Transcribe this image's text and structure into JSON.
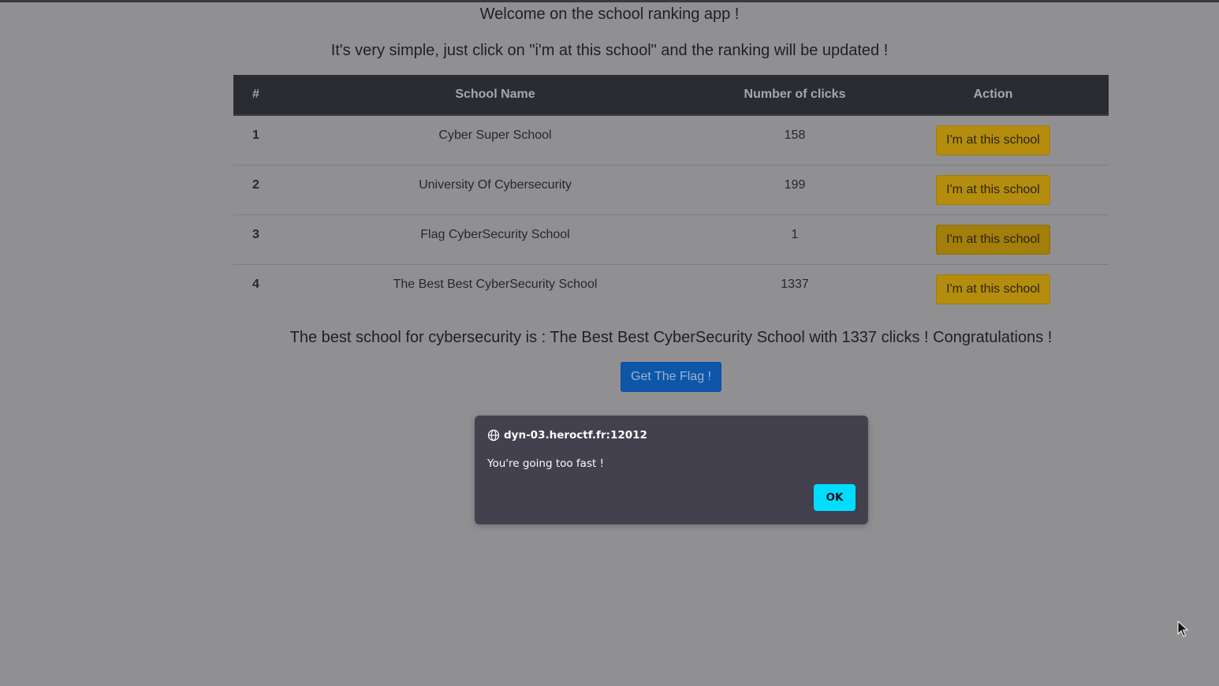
{
  "header": {
    "welcome": "Welcome on the school ranking app !",
    "intro": "It's very simple, just click on \"i'm at this school\" and the ranking will be updated !"
  },
  "table": {
    "columns": [
      "#",
      "School Name",
      "Number of clicks",
      "Action"
    ],
    "rows": [
      {
        "rank": "1",
        "name": "Cyber Super School",
        "clicks": "158",
        "action": "I'm at this school"
      },
      {
        "rank": "2",
        "name": "University Of Cybersecurity",
        "clicks": "199",
        "action": "I'm at this school"
      },
      {
        "rank": "3",
        "name": "Flag CyberSecurity School",
        "clicks": "1",
        "action": "I'm at this school"
      },
      {
        "rank": "4",
        "name": "The Best Best CyberSecurity School",
        "clicks": "1337",
        "action": "I'm at this school"
      }
    ]
  },
  "summary": "The best school for cybersecurity is : The Best Best CyberSecurity School with 1337 clicks ! Congratulations !",
  "flag_button": "Get The Flag !",
  "dialog": {
    "origin": "dyn-03.heroctf.fr:12012",
    "message": "You're going too fast !",
    "ok_label": "OK",
    "icon": "globe-icon"
  },
  "colors": {
    "backdrop": "#909092",
    "school_button": "#b48d0e",
    "flag_button": "#0e56a8",
    "dialog_bg": "#42414d",
    "ok_button": "#00ddff"
  }
}
